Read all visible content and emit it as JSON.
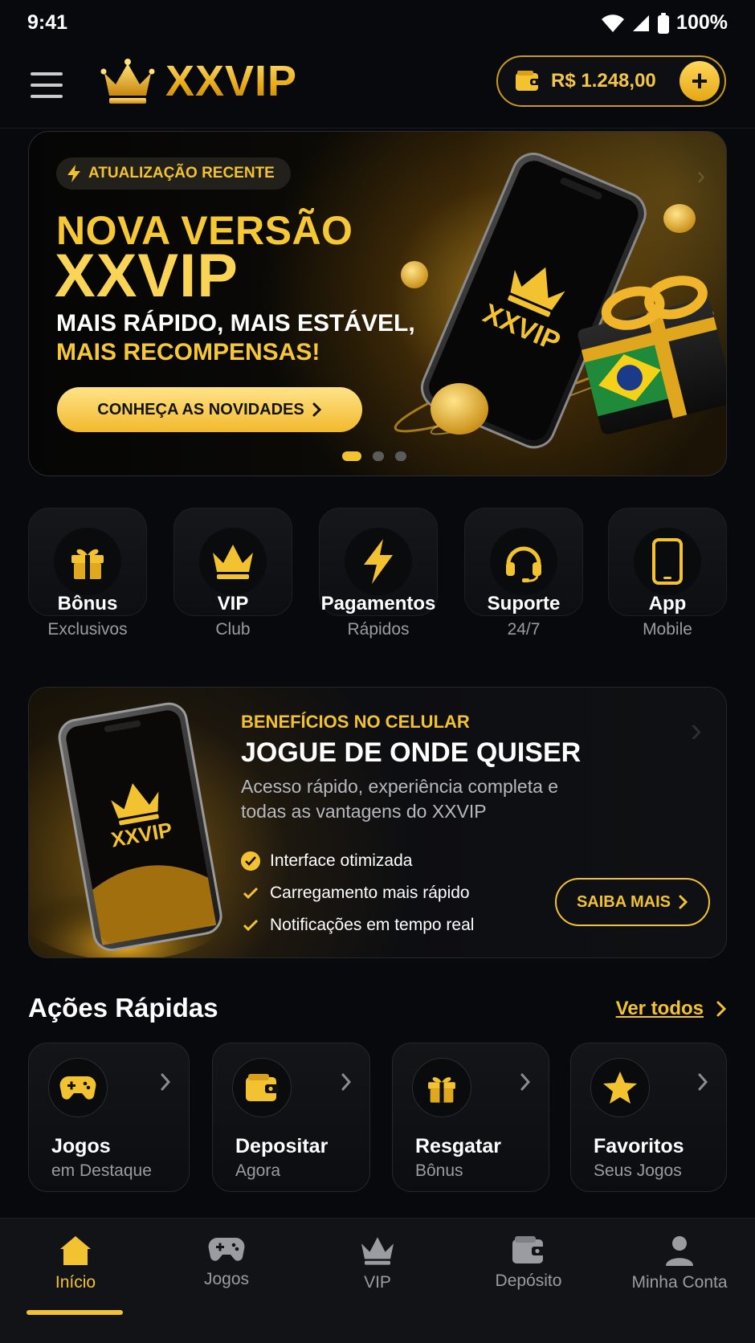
{
  "status_bar": {
    "time": "9:41",
    "battery": "100%"
  },
  "header": {
    "brand": "XXVIP",
    "balance": "R$ 1.248,00",
    "add_label": "+"
  },
  "hero": {
    "tag": "ATUALIZAÇÃO RECENTE",
    "title_line1": "NOVA VERSÃO",
    "title_line2": "XXVIP",
    "subtitle_line1": "MAIS RÁPIDO, MAIS ESTÁVEL,",
    "subtitle_line2": "MAIS RECOMPENSAS!",
    "cta": "CONHEÇA AS NOVIDADES",
    "phone_brand": "XXVIP",
    "slides_total": 3,
    "active_slide": 1
  },
  "features": [
    {
      "title": "Bônus",
      "subtitle": "Exclusivos",
      "icon": "gift-icon"
    },
    {
      "title": "VIP",
      "subtitle": "Club",
      "icon": "crown-icon"
    },
    {
      "title": "Pagamentos",
      "subtitle": "Rápidos",
      "icon": "lightning-icon"
    },
    {
      "title": "Suporte",
      "subtitle": "24/7",
      "icon": "headset-icon"
    },
    {
      "title": "App",
      "subtitle": "Mobile",
      "icon": "phone-icon"
    }
  ],
  "promo": {
    "eyebrow": "BENEFÍCIOS NO CELULAR",
    "title": "JOGUE DE ONDE QUISER",
    "description": "Acesso rápido, experiência completa e todas as vantagens do XXVIP",
    "phone_brand": "XXVIP",
    "items": [
      "Interface otimizada",
      "Carregamento mais rápido",
      "Notificações em tempo real"
    ],
    "cta": "SAIBA MAIS"
  },
  "quick_actions": {
    "title": "Ações Rápidas",
    "see_all": "Ver todos",
    "items": [
      {
        "title": "Jogos",
        "subtitle": "em Destaque",
        "icon": "gamepad-icon"
      },
      {
        "title": "Depositar",
        "subtitle": "Agora",
        "icon": "wallet-icon"
      },
      {
        "title": "Resgatar",
        "subtitle": "Bônus",
        "icon": "gift-icon"
      },
      {
        "title": "Favoritos",
        "subtitle": "Seus Jogos",
        "icon": "star-icon"
      }
    ]
  },
  "bottom_nav": {
    "active": "Início",
    "items": [
      {
        "label": "Início",
        "icon": "home-icon"
      },
      {
        "label": "Jogos",
        "icon": "gamepad-icon"
      },
      {
        "label": "VIP",
        "icon": "crown-icon"
      },
      {
        "label": "Depósito",
        "icon": "wallet-icon"
      },
      {
        "label": "Minha Conta",
        "icon": "user-icon"
      }
    ]
  },
  "colors": {
    "accent": "#f2c230",
    "background": "#07090c",
    "muted": "#9a9ca2"
  }
}
